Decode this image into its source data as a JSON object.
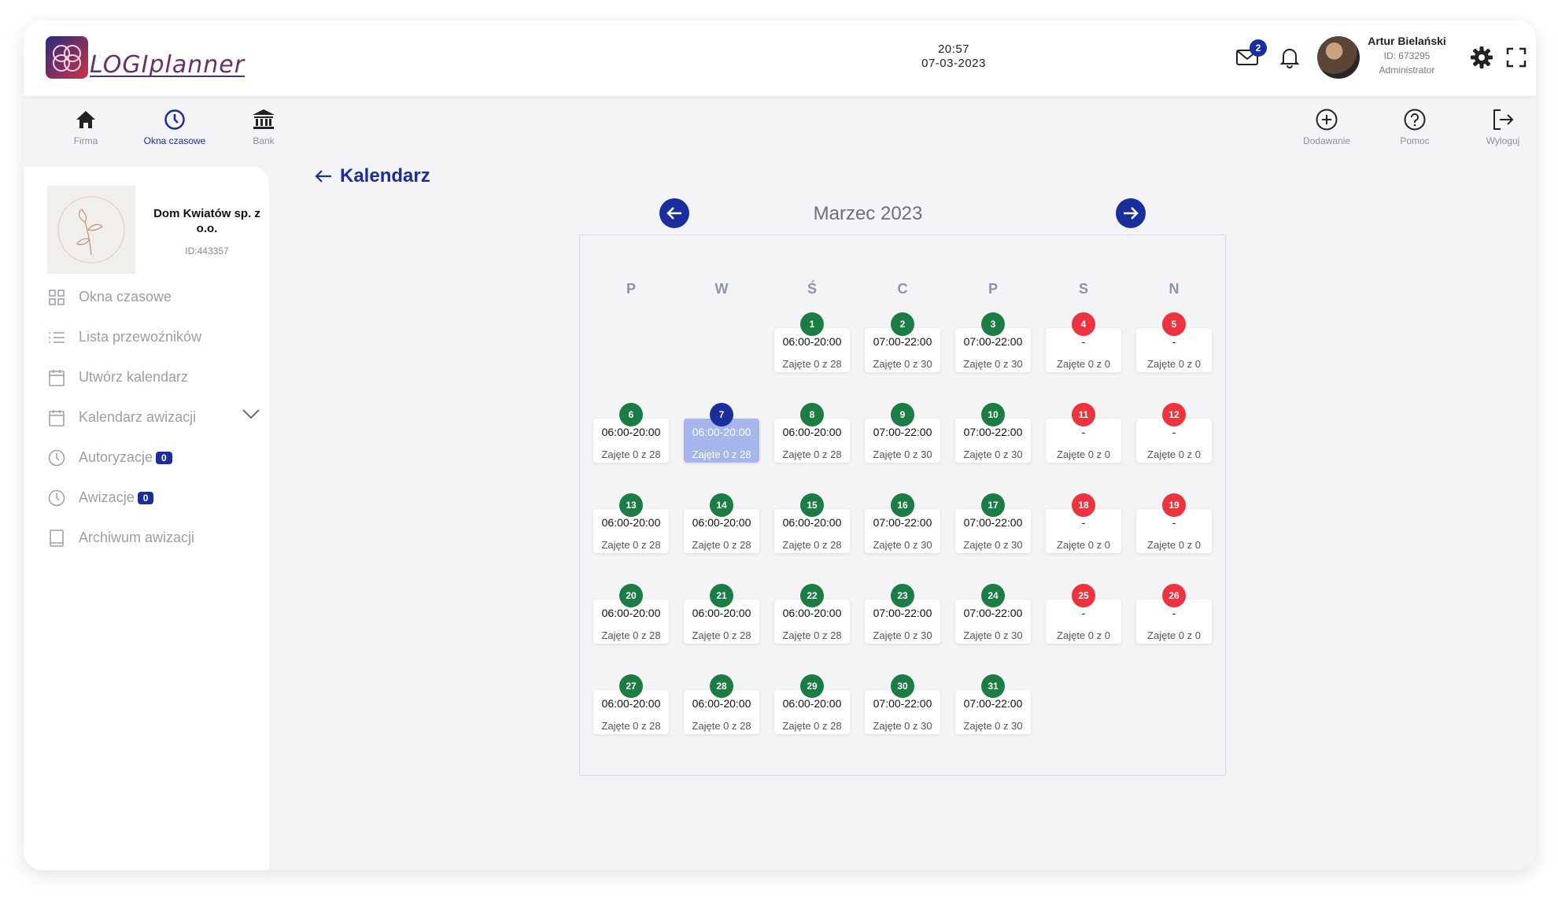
{
  "header": {
    "time": "20:57",
    "date": "07-03-2023",
    "mail_count": "2",
    "user": {
      "name": "Artur Bielański",
      "id": "ID: 673295",
      "role": "Administrator"
    },
    "logo_text": "LOGIplanner"
  },
  "topnav": {
    "left": [
      {
        "label": "Firma",
        "icon": "home-icon"
      },
      {
        "label": "Okna czasowe",
        "icon": "clock-icon"
      },
      {
        "label": "Bank",
        "icon": "bank-icon"
      }
    ],
    "right": [
      {
        "label": "Dodawanie",
        "icon": "plus-circle-icon"
      },
      {
        "label": "Pomoc",
        "icon": "help-circle-icon"
      },
      {
        "label": "Wyloguj",
        "icon": "logout-icon"
      }
    ],
    "active": "Okna czasowe"
  },
  "sidebar": {
    "company_name": "Dom Kwiatów sp. z o.o.",
    "company_id": "ID:443357",
    "menu": [
      {
        "label": "Okna czasowe",
        "icon": "grid-icon"
      },
      {
        "label": "Lista przewoźników",
        "icon": "list-icon"
      },
      {
        "label": "Utwórz kalendarz",
        "icon": "calendar-icon"
      },
      {
        "label": "Kalendarz awizacji",
        "icon": "calendar-icon"
      },
      {
        "label": "Autoryzacje",
        "icon": "clock-icon",
        "badge": "0"
      },
      {
        "label": "Awizacje",
        "icon": "clock-icon",
        "badge": "0"
      },
      {
        "label": "Archiwum awizacji",
        "icon": "book-icon"
      }
    ]
  },
  "main": {
    "title": "Kalendarz",
    "month": "Marzec 2023",
    "weekdays": [
      "P",
      "W",
      "Ś",
      "C",
      "P",
      "S",
      "N"
    ],
    "first_day_column": 2,
    "selected_day": "7",
    "colors": {
      "working": "#1b7d43",
      "closed": "#ed3340",
      "today": "#1a2e9e",
      "selected_bg": "#a6b6ec"
    },
    "days": [
      {
        "day": "1",
        "hours": "06:00-20:00",
        "occ": "Zajęte 0 z 28",
        "status": "working"
      },
      {
        "day": "2",
        "hours": "07:00-22:00",
        "occ": "Zajęte 0 z 30",
        "status": "working"
      },
      {
        "day": "3",
        "hours": "07:00-22:00",
        "occ": "Zajęte 0 z 30",
        "status": "working"
      },
      {
        "day": "4",
        "hours": "-",
        "occ": "Zajęte 0 z 0",
        "status": "closed"
      },
      {
        "day": "5",
        "hours": "-",
        "occ": "Zajęte 0 z 0",
        "status": "closed"
      },
      {
        "day": "6",
        "hours": "06:00-20:00",
        "occ": "Zajęte 0 z 28",
        "status": "working"
      },
      {
        "day": "7",
        "hours": "06:00-20:00",
        "occ": "Zajęte 0 z 28",
        "status": "today"
      },
      {
        "day": "8",
        "hours": "06:00-20:00",
        "occ": "Zajęte 0 z 28",
        "status": "working"
      },
      {
        "day": "9",
        "hours": "07:00-22:00",
        "occ": "Zajęte 0 z 30",
        "status": "working"
      },
      {
        "day": "10",
        "hours": "07:00-22:00",
        "occ": "Zajęte 0 z 30",
        "status": "working"
      },
      {
        "day": "11",
        "hours": "-",
        "occ": "Zajęte 0 z 0",
        "status": "closed"
      },
      {
        "day": "12",
        "hours": "-",
        "occ": "Zajęte 0 z 0",
        "status": "closed"
      },
      {
        "day": "13",
        "hours": "06:00-20:00",
        "occ": "Zajęte 0 z 28",
        "status": "working"
      },
      {
        "day": "14",
        "hours": "06:00-20:00",
        "occ": "Zajęte 0 z 28",
        "status": "working"
      },
      {
        "day": "15",
        "hours": "06:00-20:00",
        "occ": "Zajęte 0 z 28",
        "status": "working"
      },
      {
        "day": "16",
        "hours": "07:00-22:00",
        "occ": "Zajęte 0 z 30",
        "status": "working"
      },
      {
        "day": "17",
        "hours": "07:00-22:00",
        "occ": "Zajęte 0 z 30",
        "status": "working"
      },
      {
        "day": "18",
        "hours": "-",
        "occ": "Zajęte 0 z 0",
        "status": "closed"
      },
      {
        "day": "19",
        "hours": "-",
        "occ": "Zajęte 0 z 0",
        "status": "closed"
      },
      {
        "day": "20",
        "hours": "06:00-20:00",
        "occ": "Zajęte 0 z 28",
        "status": "working"
      },
      {
        "day": "21",
        "hours": "06:00-20:00",
        "occ": "Zajęte 0 z 28",
        "status": "working"
      },
      {
        "day": "22",
        "hours": "06:00-20:00",
        "occ": "Zajęte 0 z 28",
        "status": "working"
      },
      {
        "day": "23",
        "hours": "07:00-22:00",
        "occ": "Zajęte 0 z 30",
        "status": "working"
      },
      {
        "day": "24",
        "hours": "07:00-22:00",
        "occ": "Zajęte 0 z 30",
        "status": "working"
      },
      {
        "day": "25",
        "hours": "-",
        "occ": "Zajęte 0 z 0",
        "status": "closed"
      },
      {
        "day": "26",
        "hours": "-",
        "occ": "Zajęte 0 z 0",
        "status": "closed"
      },
      {
        "day": "27",
        "hours": "06:00-20:00",
        "occ": "Zajęte 0 z 28",
        "status": "working"
      },
      {
        "day": "28",
        "hours": "06:00-20:00",
        "occ": "Zajęte 0 z 28",
        "status": "working"
      },
      {
        "day": "29",
        "hours": "06:00-20:00",
        "occ": "Zajęte 0 z 28",
        "status": "working"
      },
      {
        "day": "30",
        "hours": "07:00-22:00",
        "occ": "Zajęte 0 z 30",
        "status": "working"
      },
      {
        "day": "31",
        "hours": "07:00-22:00",
        "occ": "Zajęte 0 z 30",
        "status": "working"
      }
    ]
  }
}
